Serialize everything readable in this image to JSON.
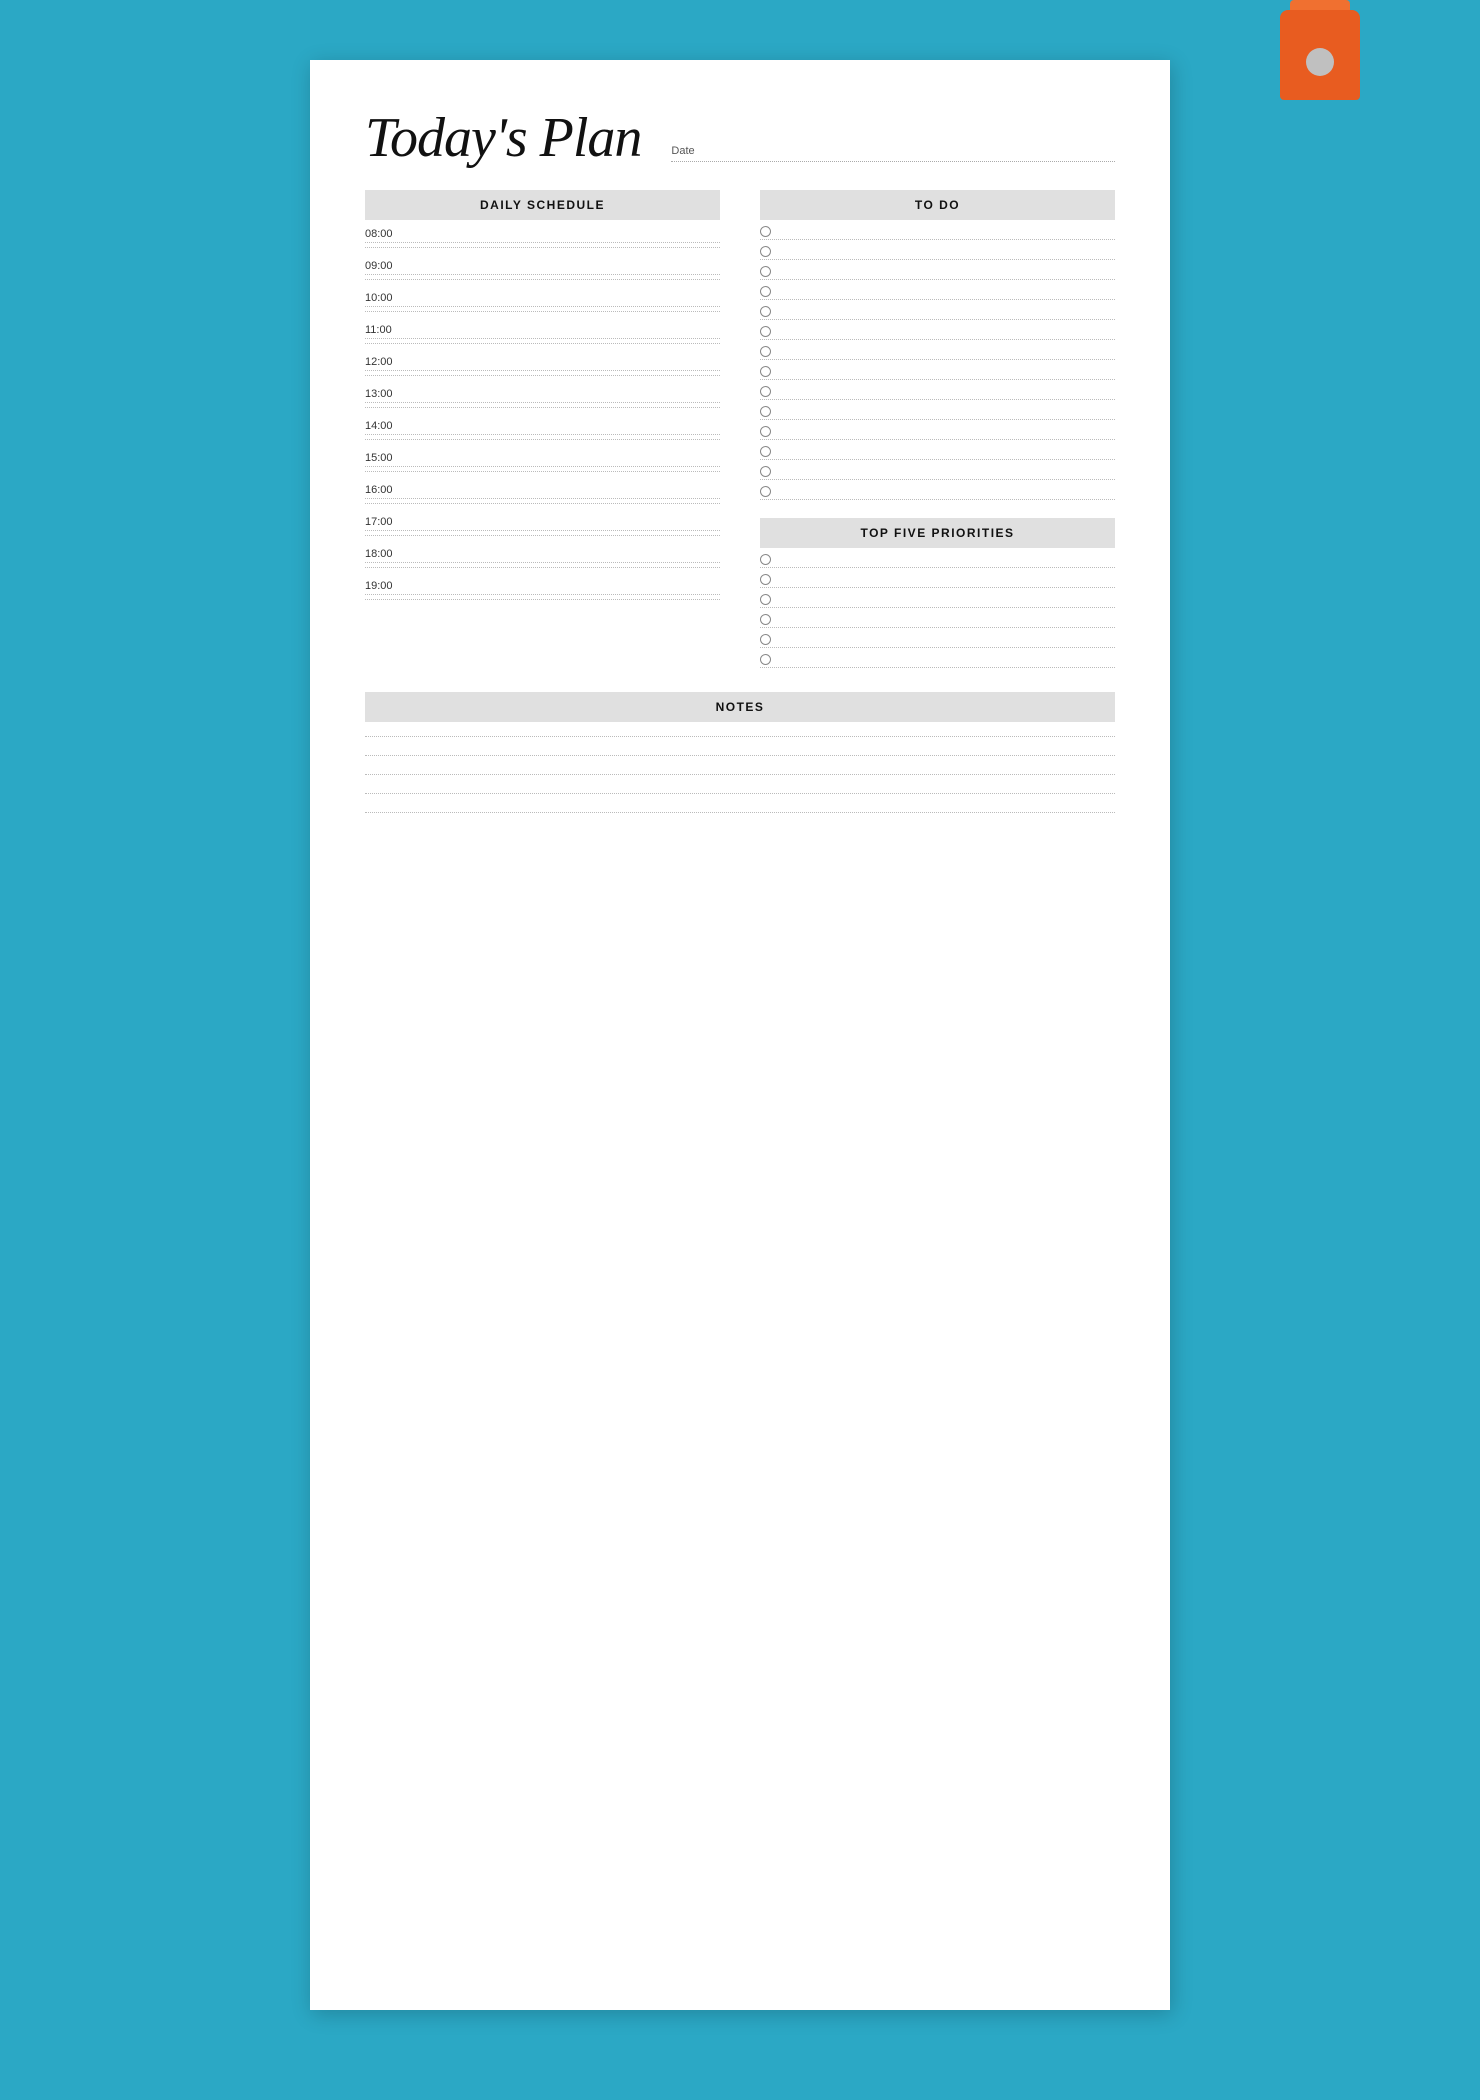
{
  "page": {
    "title": "Today's Plan",
    "date_label": "Date",
    "background_color": "#2ba8c5",
    "paper_color": "#ffffff"
  },
  "daily_schedule": {
    "header": "DAILY SCHEDULE",
    "times": [
      "08:00",
      "09:00",
      "10:00",
      "11:00",
      "12:00",
      "13:00",
      "14:00",
      "15:00",
      "16:00",
      "17:00",
      "18:00",
      "19:00"
    ]
  },
  "todo": {
    "header": "TO DO",
    "item_count": 14
  },
  "top_five_priorities": {
    "header": "TOP FIVE PRIORITIES",
    "item_count": 6
  },
  "notes": {
    "header": "NOTES",
    "line_count": 5
  }
}
